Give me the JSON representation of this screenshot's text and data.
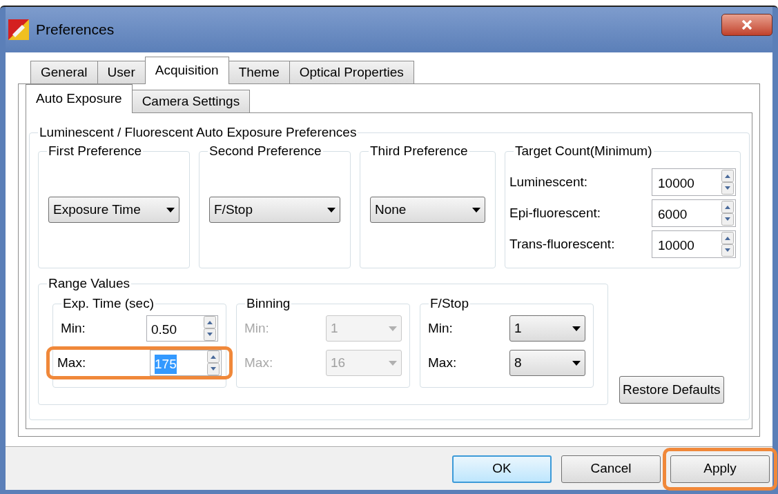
{
  "window": {
    "title": "Preferences"
  },
  "tabs": [
    {
      "label": "General",
      "selected": false
    },
    {
      "label": "User",
      "selected": false
    },
    {
      "label": "Acquisition",
      "selected": true
    },
    {
      "label": "Theme",
      "selected": false
    },
    {
      "label": "Optical Properties",
      "selected": false
    }
  ],
  "subtabs": [
    {
      "label": "Auto Exposure",
      "selected": true
    },
    {
      "label": "Camera Settings",
      "selected": false
    }
  ],
  "auto_exposure": {
    "title": "Luminescent / Fluorescent Auto Exposure Preferences",
    "preferences": [
      {
        "title": "First Preference",
        "value": "Exposure Time"
      },
      {
        "title": "Second Preference",
        "value": "F/Stop"
      },
      {
        "title": "Third Preference",
        "value": "None"
      }
    ],
    "target_count": {
      "title": "Target Count(Minimum)",
      "rows": [
        {
          "label": "Luminescent:",
          "value": "10000"
        },
        {
          "label": "Epi-fluorescent:",
          "value": "6000"
        },
        {
          "label": "Trans-fluorescent:",
          "value": "10000"
        }
      ]
    },
    "range_values": {
      "title": "Range Values",
      "groups": [
        {
          "title": "Exp. Time (sec)",
          "kind": "spin",
          "disabled": false,
          "rows": [
            {
              "label": "Min:",
              "value": "0.50",
              "highlighted": false,
              "text_selected": false
            },
            {
              "label": "Max:",
              "value": "175",
              "highlighted": true,
              "text_selected": true
            }
          ]
        },
        {
          "title": "Binning",
          "kind": "combo",
          "disabled": true,
          "rows": [
            {
              "label": "Min:",
              "value": "1",
              "highlighted": false
            },
            {
              "label": "Max:",
              "value": "16",
              "highlighted": false
            }
          ]
        },
        {
          "title": "F/Stop",
          "kind": "combo",
          "disabled": false,
          "rows": [
            {
              "label": "Min:",
              "value": "1",
              "highlighted": false
            },
            {
              "label": "Max:",
              "value": "8",
              "highlighted": false
            }
          ]
        }
      ]
    },
    "restore_button": "Restore Defaults"
  },
  "buttons": [
    {
      "label": "OK",
      "default": true,
      "highlighted": false
    },
    {
      "label": "Cancel",
      "default": false,
      "highlighted": false
    },
    {
      "label": "Apply",
      "default": false,
      "highlighted": true
    }
  ]
}
